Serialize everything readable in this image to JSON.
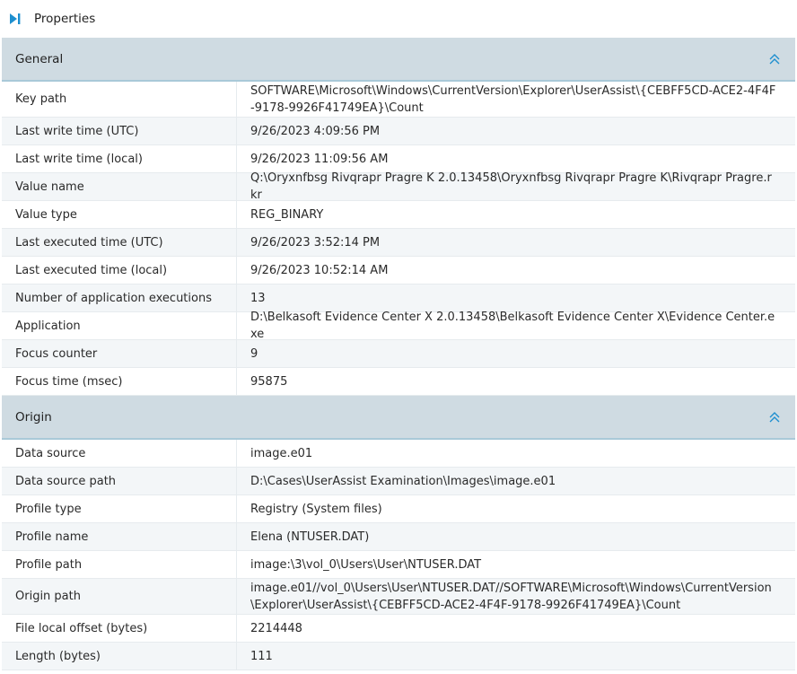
{
  "pane": {
    "title": "Properties",
    "icon": "pane-expand-icon"
  },
  "colors": {
    "section_header_bg": "#cfdbe2",
    "accent": "#1e8fcf"
  },
  "sections": [
    {
      "title": "General",
      "rows": [
        {
          "key": "Key path",
          "value": "SOFTWARE\\Microsoft\\Windows\\CurrentVersion\\Explorer\\UserAssist\\{CEBFF5CD-ACE2-4F4F-9178-9926F41749EA}\\Count"
        },
        {
          "key": "Last write time (UTC)",
          "value": "9/26/2023 4:09:56 PM"
        },
        {
          "key": "Last write time (local)",
          "value": "9/26/2023 11:09:56 AM"
        },
        {
          "key": "Value name",
          "value": "Q:\\Oryxnfbsg Rivqrapr Pragre K 2.0.13458\\Oryxnfbsg Rivqrapr Pragre K\\Rivqrapr Pragre.rkr"
        },
        {
          "key": "Value type",
          "value": "REG_BINARY"
        },
        {
          "key": "Last executed time (UTC)",
          "value": "9/26/2023 3:52:14 PM"
        },
        {
          "key": "Last executed time (local)",
          "value": "9/26/2023 10:52:14 AM"
        },
        {
          "key": "Number of application executions",
          "value": "13"
        },
        {
          "key": "Application",
          "value": "D:\\Belkasoft Evidence Center X 2.0.13458\\Belkasoft Evidence Center X\\Evidence Center.exe"
        },
        {
          "key": "Focus counter",
          "value": "9"
        },
        {
          "key": "Focus time (msec)",
          "value": "95875"
        }
      ]
    },
    {
      "title": "Origin",
      "rows": [
        {
          "key": "Data source",
          "value": "image.e01"
        },
        {
          "key": "Data source path",
          "value": "D:\\Cases\\UserAssist Examination\\Images\\image.e01"
        },
        {
          "key": "Profile type",
          "value": "Registry (System files)"
        },
        {
          "key": "Profile name",
          "value": "Elena (NTUSER.DAT)"
        },
        {
          "key": "Profile path",
          "value": "image:\\3\\vol_0\\Users\\User\\NTUSER.DAT"
        },
        {
          "key": "Origin path",
          "value": "image.e01//vol_0\\Users\\User\\NTUSER.DAT//SOFTWARE\\Microsoft\\Windows\\CurrentVersion\\Explorer\\UserAssist\\{CEBFF5CD-ACE2-4F4F-9178-9926F41749EA}\\Count"
        },
        {
          "key": "File local offset (bytes)",
          "value": "2214448"
        },
        {
          "key": "Length (bytes)",
          "value": "111"
        }
      ]
    }
  ]
}
